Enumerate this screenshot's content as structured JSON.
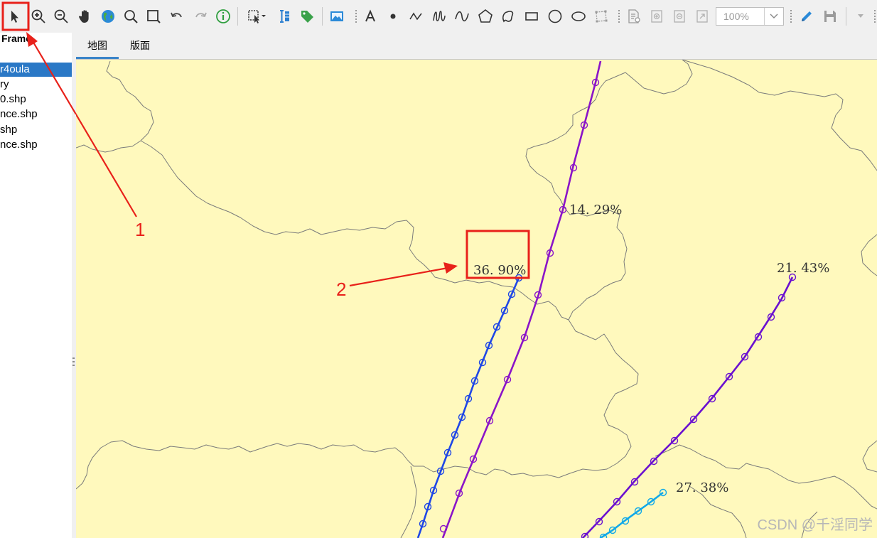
{
  "toolbar": {
    "zoom": {
      "value": "100%"
    },
    "icons": [
      "select-arrow-icon",
      "zoom-in-icon",
      "zoom-out-icon",
      "pan-hand-icon",
      "globe-icon",
      "magnify-icon",
      "zoom-rect-icon",
      "undo-icon",
      "redo-icon",
      "identify-info-icon",
      "select-features-icon",
      "attribute-table-icon",
      "label-tag-icon",
      "image-icon",
      "text-icon",
      "point-icon",
      "polyline-icon",
      "freehand-icon",
      "curve-icon",
      "polygon-icon",
      "freehand-polygon-icon",
      "rectangle-icon",
      "circle-icon",
      "ellipse-icon",
      "edit-vertices-icon",
      "page-setup-icon",
      "export-icon",
      "print-preview-icon",
      "full-extent-icon",
      "pencil-edit-icon",
      "save-icon",
      "overflow-arrow-icon"
    ]
  },
  "sidebar": {
    "header": "Frame",
    "items": [
      {
        "label": "r4oula",
        "selected": true
      },
      {
        "label": "ry"
      },
      {
        "label": "0.shp"
      },
      {
        "label": "nce.shp"
      },
      {
        "label": "shp"
      },
      {
        "label": "nce.shp"
      }
    ]
  },
  "tabs": [
    {
      "label": "地图",
      "active": true
    },
    {
      "label": "版面"
    }
  ],
  "map": {
    "background_color": "#fff9bd",
    "track_labels": [
      {
        "text": "14. 29%",
        "color": "#8a14c8"
      },
      {
        "text": "36. 90%",
        "color": "#1f47e6"
      },
      {
        "text": "21. 43%",
        "color": "#6a10d0"
      },
      {
        "text": "27. 38%",
        "color": "#10a8e8"
      }
    ]
  },
  "annotations": {
    "label_1": "1",
    "label_2": "2",
    "color": "#e8211a"
  },
  "watermark": "CSDN @千淫同学"
}
